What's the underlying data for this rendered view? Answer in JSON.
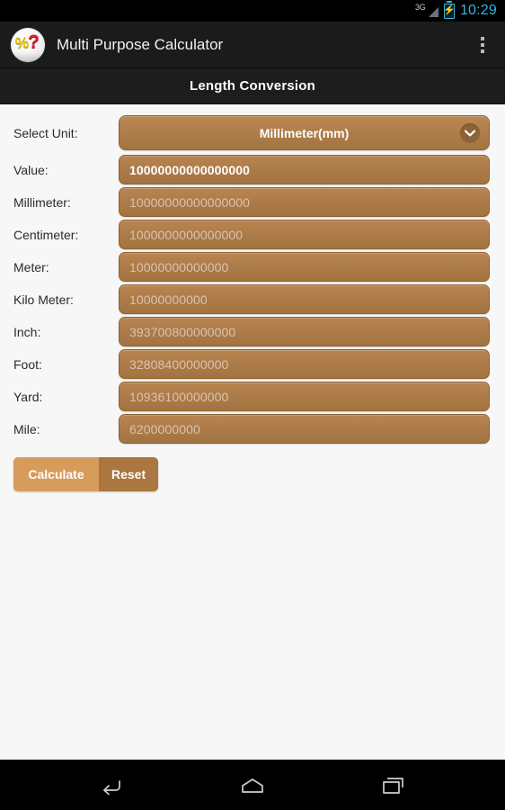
{
  "status_bar": {
    "network_label": "3G",
    "signal_icon": "signal-triangle-icon",
    "battery_icon": "battery-charging-icon",
    "time": "10:29"
  },
  "action_bar": {
    "app_icon": "percent-question-app-icon",
    "title": "Multi Purpose Calculator",
    "overflow_icon": "overflow-menu-icon"
  },
  "subtitle_bar": {
    "title": "Length Conversion"
  },
  "form": {
    "select_unit": {
      "label": "Select Unit:",
      "selected": "Millimeter(mm)",
      "chevron_icon": "chevron-down-icon"
    },
    "value": {
      "label": "Value:",
      "value": "10000000000000000"
    },
    "results": [
      {
        "label": "Millimeter:",
        "value": "10000000000000000"
      },
      {
        "label": "Centimeter:",
        "value": "1000000000000000"
      },
      {
        "label": "Meter:",
        "value": "10000000000000"
      },
      {
        "label": "Kilo Meter:",
        "value": "10000000000"
      },
      {
        "label": "Inch:",
        "value": "393700800000000"
      },
      {
        "label": "Foot:",
        "value": "32808400000000"
      },
      {
        "label": "Yard:",
        "value": "10936100000000"
      },
      {
        "label": "Mile:",
        "value": "6200000000"
      }
    ]
  },
  "buttons": {
    "calculate": "Calculate",
    "reset": "Reset"
  },
  "nav_bar": {
    "back_icon": "back-arrow-icon",
    "home_icon": "home-icon",
    "recents_icon": "recent-apps-icon"
  },
  "colors": {
    "field_brown": "#ad7c4a",
    "field_border": "#8d6134",
    "calculate_button": "#d79b5b",
    "reset_button": "#a9773f",
    "accent_blue": "#33b5e5",
    "page_background": "#f7f7f7",
    "bar_black": "#1b1b1b"
  }
}
